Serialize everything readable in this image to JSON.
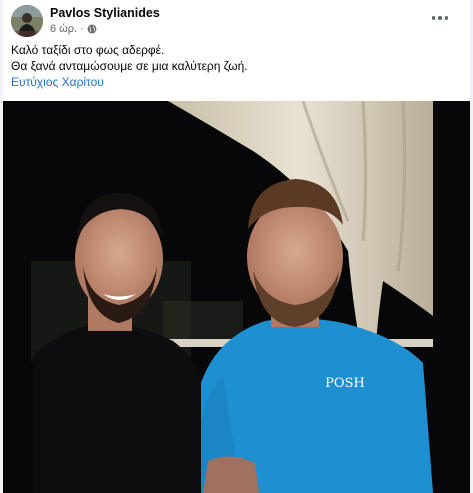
{
  "post": {
    "author": "Pavlos Stylianides",
    "timestamp": "6 ώρ.",
    "separator": "·",
    "privacy_icon": "globe-icon",
    "more_icon": "more-options-icon",
    "text_lines": [
      "Καλό ταξίδι στο φως αδερφέ.",
      "Θα ξανά ανταμώσουμε σε μια καλύτερη ζωή."
    ],
    "mention": "Ευτύχιος Χαρίτου",
    "shirt_text": "POSH"
  },
  "colors": {
    "link": "#216fdb",
    "background": "#f0f2f5",
    "card": "#ffffff",
    "secondary_text": "#65676b"
  }
}
